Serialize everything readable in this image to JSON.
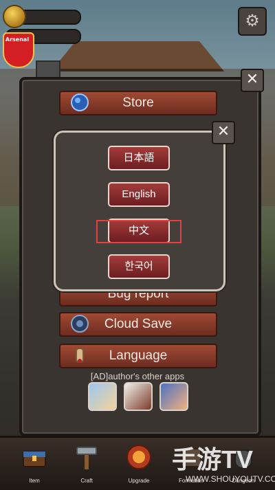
{
  "hud": {
    "coins_value": "",
    "badge_text": "Arsenal"
  },
  "menu": {
    "store_label": "Store",
    "bug_report_label": "Bug report",
    "cloud_save_label": "Cloud Save",
    "language_label": "Language"
  },
  "language_dialog": {
    "options": [
      "日本語",
      "English",
      "中文",
      "한국어"
    ],
    "selected": "中文"
  },
  "ads": {
    "label": "[AD]author's other apps"
  },
  "nav": {
    "items": [
      "Item",
      "Craft",
      "Upgrade",
      "Formation",
      "Dungeon"
    ]
  },
  "watermark": {
    "main": "手游TV",
    "sub": "WWW.SHOUYOUTV.COM"
  },
  "colors": {
    "menu_button": "#8b3a2a",
    "language_button": "#8f2a2d",
    "highlight": "#e24141"
  }
}
